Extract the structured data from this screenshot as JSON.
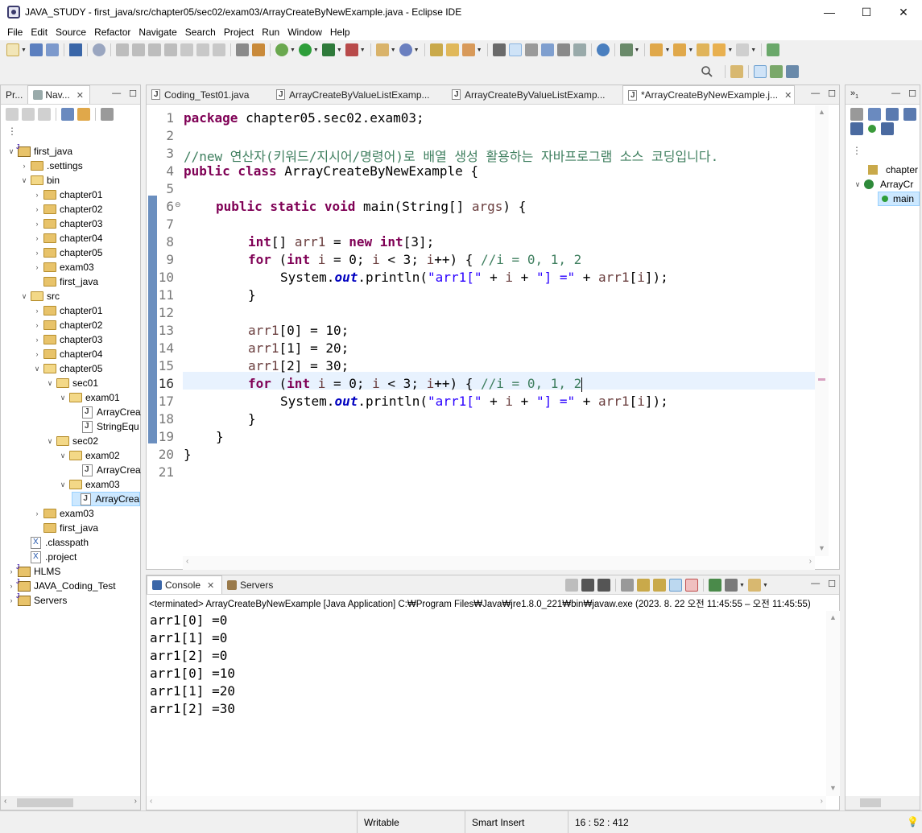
{
  "window": {
    "title": "JAVA_STUDY - first_java/src/chapter05/sec02/exam03/ArrayCreateByNewExample.java - Eclipse IDE"
  },
  "menu": [
    "File",
    "Edit",
    "Source",
    "Refactor",
    "Navigate",
    "Search",
    "Project",
    "Run",
    "Window",
    "Help"
  ],
  "left_panel": {
    "tabs": [
      {
        "label": "Pr..."
      },
      {
        "label": "Nav..."
      }
    ],
    "tree": [
      {
        "label": "first_java",
        "type": "project",
        "depth": 0,
        "expanded": true
      },
      {
        "label": ".settings",
        "type": "folder",
        "depth": 1,
        "expanded": false
      },
      {
        "label": "bin",
        "type": "folder",
        "depth": 1,
        "expanded": true
      },
      {
        "label": "chapter01",
        "type": "folder",
        "depth": 2,
        "expanded": false
      },
      {
        "label": "chapter02",
        "type": "folder",
        "depth": 2,
        "expanded": false
      },
      {
        "label": "chapter03",
        "type": "folder",
        "depth": 2,
        "expanded": false
      },
      {
        "label": "chapter04",
        "type": "folder",
        "depth": 2,
        "expanded": false
      },
      {
        "label": "chapter05",
        "type": "folder",
        "depth": 2,
        "expanded": false
      },
      {
        "label": "exam03",
        "type": "folder",
        "depth": 2,
        "expanded": false
      },
      {
        "label": "first_java",
        "type": "folder",
        "depth": 2,
        "leaf": true
      },
      {
        "label": "src",
        "type": "folder",
        "depth": 1,
        "expanded": true
      },
      {
        "label": "chapter01",
        "type": "folder",
        "depth": 2,
        "expanded": false
      },
      {
        "label": "chapter02",
        "type": "folder",
        "depth": 2,
        "expanded": false
      },
      {
        "label": "chapter03",
        "type": "folder",
        "depth": 2,
        "expanded": false
      },
      {
        "label": "chapter04",
        "type": "folder",
        "depth": 2,
        "expanded": false
      },
      {
        "label": "chapter05",
        "type": "folder",
        "depth": 2,
        "expanded": true
      },
      {
        "label": "sec01",
        "type": "folder",
        "depth": 3,
        "expanded": true
      },
      {
        "label": "exam01",
        "type": "folder",
        "depth": 4,
        "expanded": true
      },
      {
        "label": "ArrayCrea",
        "type": "java",
        "depth": 5
      },
      {
        "label": "StringEqu",
        "type": "java",
        "depth": 5
      },
      {
        "label": "sec02",
        "type": "folder",
        "depth": 3,
        "expanded": true
      },
      {
        "label": "exam02",
        "type": "folder",
        "depth": 4,
        "expanded": true
      },
      {
        "label": "ArrayCrea",
        "type": "java",
        "depth": 5
      },
      {
        "label": "exam03",
        "type": "folder",
        "depth": 4,
        "expanded": true
      },
      {
        "label": "ArrayCrea",
        "type": "java",
        "depth": 5,
        "selected": true
      },
      {
        "label": "exam03",
        "type": "folder",
        "depth": 2,
        "expanded": false
      },
      {
        "label": "first_java",
        "type": "folder",
        "depth": 2,
        "leaf": true
      },
      {
        "label": ".classpath",
        "type": "xml",
        "depth": 1
      },
      {
        "label": ".project",
        "type": "xml",
        "depth": 1
      },
      {
        "label": "HLMS",
        "type": "project",
        "depth": 0,
        "expanded": false
      },
      {
        "label": "JAVA_Coding_Test",
        "type": "project",
        "depth": 0,
        "expanded": false
      },
      {
        "label": "Servers",
        "type": "project",
        "depth": 0,
        "expanded": false
      }
    ]
  },
  "editor": {
    "tabs": [
      {
        "label": "Coding_Test01.java"
      },
      {
        "label": "ArrayCreateByValueListExamp..."
      },
      {
        "label": "ArrayCreateByValueListExamp..."
      },
      {
        "label": "*ArrayCreateByNewExample.j..."
      }
    ],
    "line_numbers": [
      "1",
      "2",
      "3",
      "4",
      "5",
      "6",
      "7",
      "8",
      "9",
      "10",
      "11",
      "12",
      "13",
      "14",
      "15",
      "16",
      "17",
      "18",
      "19",
      "20",
      "21"
    ],
    "current_line": 16
  },
  "code": {
    "l1_kw": "package",
    "l1_rest": " chapter05.sec02.exam03;",
    "l3_comment": "//new 연산자(키워드/지시어/명령어)로 배열 생성 활용하는 자바프로그램 소스 코딩입니다.",
    "l4_kw": "public class",
    "l4_rest": " ArrayCreateByNewExample {",
    "l6_kw": "public static void",
    "l6_rest": " main(String[] ",
    "l6_var": "args",
    "l6_end": ") {",
    "l8_kw": "int",
    "l8_rest": "[] ",
    "l8_var": "arr1",
    "l8_eq": " = ",
    "l8_kw2": "new int",
    "l8_end": "[3];",
    "for_kw": "for",
    "for_open": " (",
    "for_int": "int",
    "for_i1": " i",
    "for_mid1": " = 0; ",
    "for_i2": "i",
    "for_mid2": " < 3; ",
    "for_i3": "i",
    "for_end": "++) { ",
    "l9_comment": "//i = 0, 1, 2",
    "print_sys": "System.",
    "print_out": "out",
    "print_fn": ".println(",
    "print_s1": "\"arr1[\"",
    "print_p1": " + ",
    "print_i": "i",
    "print_p2": " + ",
    "print_s2": "\"] =\"",
    "print_p3": " + ",
    "print_arr": "arr1",
    "print_idx": "[",
    "print_i2": "i",
    "print_end": "]);",
    "brace_close": "}",
    "l13_var": "arr1",
    "l13_rest": "[0] = 10;",
    "l14_var": "arr1",
    "l14_rest": "[1] = 20;",
    "l15_var": "arr1",
    "l15_rest": "[2] = 30;"
  },
  "console": {
    "tabs": [
      {
        "label": "Console"
      },
      {
        "label": "Servers"
      }
    ],
    "status_line": "<terminated> ArrayCreateByNewExample [Java Application] C:₩Program Files₩Java₩jre1.8.0_221₩bin₩javaw.exe  (2023. 8. 22 오전 11:45:55 – 오전 11:45:55)",
    "output": [
      "arr1[0] =0",
      "arr1[1] =0",
      "arr1[2] =0",
      "arr1[0] =10",
      "arr1[1] =20",
      "arr1[2] =30"
    ]
  },
  "outline": {
    "items": [
      {
        "label": "chapter"
      },
      {
        "label": "ArrayCr"
      },
      {
        "label": "main"
      }
    ]
  },
  "statusbar": {
    "writable": "Writable",
    "insert_mode": "Smart Insert",
    "position": "16 : 52 : 412"
  }
}
